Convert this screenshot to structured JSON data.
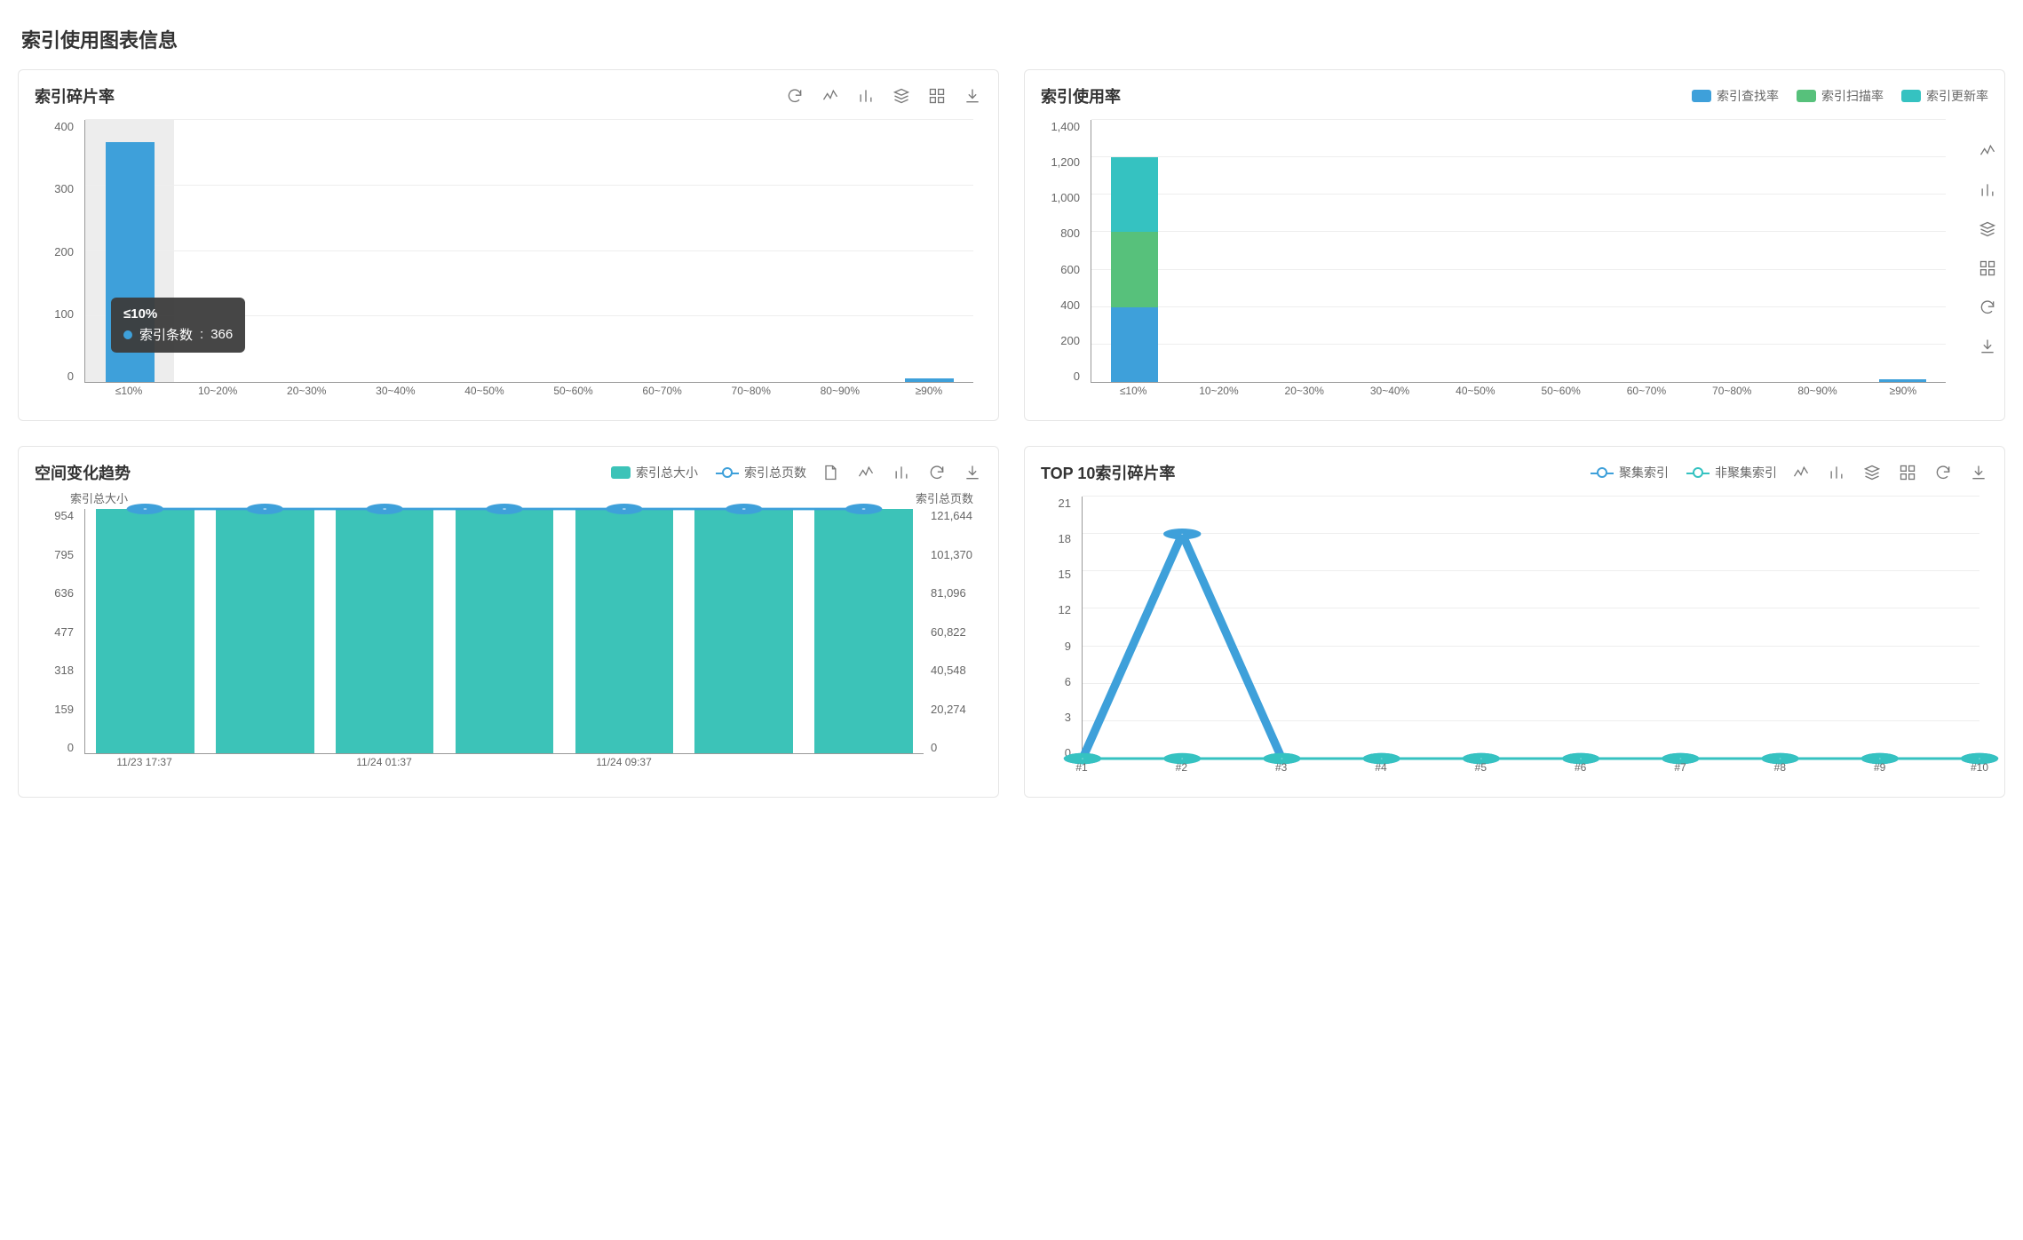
{
  "page_title": "索引使用图表信息",
  "colors": {
    "blue": "#3ea0da",
    "green": "#57c17b",
    "teal": "#35c2c1",
    "tealBar": "#3cc3b8",
    "tooltipBg": "#555"
  },
  "icons": [
    "refresh",
    "line",
    "bar",
    "stack",
    "grid",
    "download",
    "doc"
  ],
  "panels": {
    "frag": {
      "title": "索引碎片率",
      "tooltip": {
        "category": "≤10%",
        "series": "索引条数",
        "value": 366
      }
    },
    "usage": {
      "title": "索引使用率",
      "legend": [
        "索引查找率",
        "索引扫描率",
        "索引更新率"
      ]
    },
    "trend": {
      "title": "空间变化趋势",
      "legend": [
        "索引总大小",
        "索引总页数"
      ],
      "y_left_title": "索引总大小",
      "y_right_title": "索引总页数"
    },
    "top10": {
      "title": "TOP 10索引碎片率",
      "legend": [
        "聚集索引",
        "非聚集索引"
      ]
    }
  },
  "chart_data": [
    {
      "id": "frag",
      "type": "bar",
      "title": "索引碎片率",
      "categories": [
        "≤10%",
        "10~20%",
        "20~30%",
        "30~40%",
        "40~50%",
        "50~60%",
        "60~70%",
        "70~80%",
        "80~90%",
        "≥90%"
      ],
      "series": [
        {
          "name": "索引条数",
          "values": [
            366,
            0,
            0,
            0,
            0,
            0,
            0,
            0,
            0,
            6
          ]
        }
      ],
      "ylabel": "",
      "ylim": [
        0,
        400
      ],
      "yticks": [
        0,
        100,
        200,
        300,
        400
      ]
    },
    {
      "id": "usage",
      "type": "bar_stacked",
      "title": "索引使用率",
      "categories": [
        "≤10%",
        "10~20%",
        "20~30%",
        "30~40%",
        "40~50%",
        "50~60%",
        "60~70%",
        "70~80%",
        "80~90%",
        "≥90%"
      ],
      "series": [
        {
          "name": "索引查找率",
          "color": "#3ea0da",
          "values": [
            400,
            0,
            0,
            0,
            0,
            0,
            0,
            0,
            0,
            15
          ]
        },
        {
          "name": "索引扫描率",
          "color": "#57c17b",
          "values": [
            400,
            0,
            0,
            0,
            0,
            0,
            0,
            0,
            0,
            0
          ]
        },
        {
          "name": "索引更新率",
          "color": "#35c2c1",
          "values": [
            400,
            0,
            0,
            0,
            0,
            0,
            0,
            0,
            0,
            0
          ]
        }
      ],
      "ylim": [
        0,
        1400
      ],
      "yticks": [
        0,
        200,
        400,
        600,
        800,
        1000,
        1200,
        1400
      ]
    },
    {
      "id": "trend",
      "type": "bar_line_dual",
      "title": "空间变化趋势",
      "x": [
        "11/23 17:37",
        "",
        "11/24 01:37",
        "",
        "11/24 09:37",
        ""
      ],
      "bar_series": {
        "name": "索引总大小",
        "values": [
          954,
          954,
          954,
          954,
          954,
          954,
          954
        ]
      },
      "line_series": {
        "name": "索引总页数",
        "values": [
          121644,
          121644,
          121644,
          121644,
          121644,
          121644,
          121644
        ]
      },
      "ylim_left": [
        0,
        954
      ],
      "yticks_left": [
        0,
        159,
        318,
        477,
        636,
        795,
        954
      ],
      "ylim_right": [
        0,
        121644
      ],
      "yticks_right": [
        0,
        20274,
        40548,
        60822,
        81096,
        101370,
        121644
      ]
    },
    {
      "id": "top10",
      "type": "line",
      "title": "TOP 10索引碎片率",
      "categories": [
        "#1",
        "#2",
        "#3",
        "#4",
        "#5",
        "#6",
        "#7",
        "#8",
        "#9",
        "#10"
      ],
      "series": [
        {
          "name": "聚集索引",
          "color": "#3ea0da",
          "values": [
            0,
            18,
            0,
            0,
            0,
            0,
            0,
            0,
            0,
            0
          ]
        },
        {
          "name": "非聚集索引",
          "color": "#35c2c1",
          "values": [
            0,
            0,
            0,
            0,
            0,
            0,
            0,
            0,
            0,
            0
          ]
        }
      ],
      "ylim": [
        0,
        21
      ],
      "yticks": [
        0,
        3,
        6,
        9,
        12,
        15,
        18,
        21
      ]
    }
  ]
}
